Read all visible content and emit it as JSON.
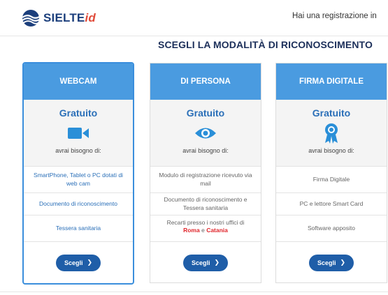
{
  "header": {
    "logo_text": "SIELTE",
    "logo_suffix": "id",
    "right_text": "Hai una registrazione in"
  },
  "page_title": "SCEGLI LA MODALITÀ DI RICONOSCIMENTO",
  "colors": {
    "header_blue": "#4a9be0",
    "button_blue": "#1f5ea8",
    "price_blue": "#2a6fb8",
    "accent_red": "#e0262c"
  },
  "cards": [
    {
      "title": "WEBCAM",
      "price": "Gratuito",
      "icon": "video-camera-icon",
      "need": "avrai bisogno di:",
      "requirements": [
        "SmartPhone, Tablet o PC dotati di web cam",
        "Documento di riconoscimento",
        "Tessera sanitaria"
      ],
      "button": "Scegli",
      "selected": true
    },
    {
      "title": "DI PERSONA",
      "price": "Gratuito",
      "icon": "eye-icon",
      "need": "avrai bisogno di:",
      "requirements": [
        "Modulo di registrazione ricevuto via mail",
        "Documento di riconoscimento e Tessera sanitaria"
      ],
      "req3": {
        "pre": "Recarti presso i nostri uffici di",
        "city1": "Roma",
        "and": "e",
        "city2": "Catania"
      },
      "button": "Scegli",
      "selected": false
    },
    {
      "title": "FIRMA DIGITALE",
      "price": "Gratuito",
      "icon": "award-badge-icon",
      "need": "avrai bisogno di:",
      "requirements": [
        "Firma Digitale",
        "PC e lettore Smart Card",
        "Software apposito"
      ],
      "button": "Scegli",
      "selected": false
    }
  ]
}
